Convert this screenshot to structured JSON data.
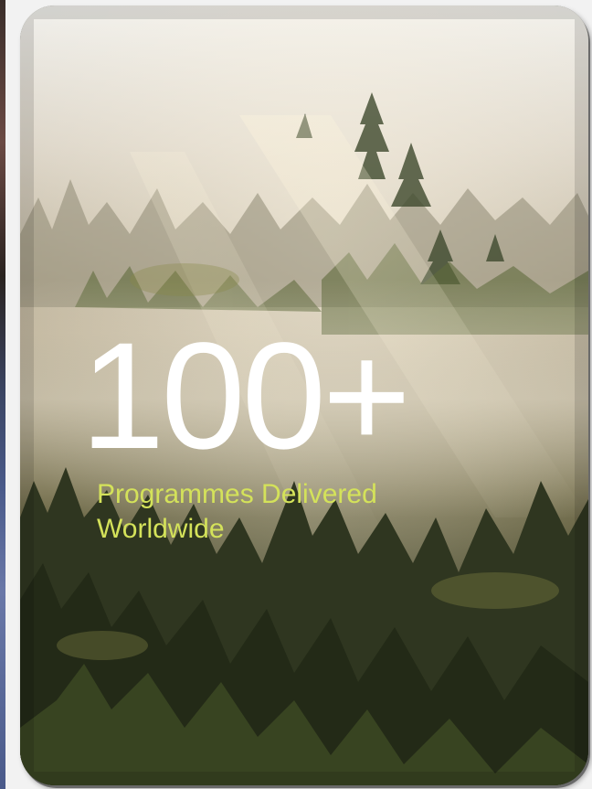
{
  "card": {
    "stat_value": "100+",
    "caption_line1": "Programmes Delivered",
    "caption_line2": "Worldwide"
  },
  "colors": {
    "stat_value": "#ffffff",
    "caption": "#d4e25a",
    "page_background": "#f2f2f2"
  }
}
